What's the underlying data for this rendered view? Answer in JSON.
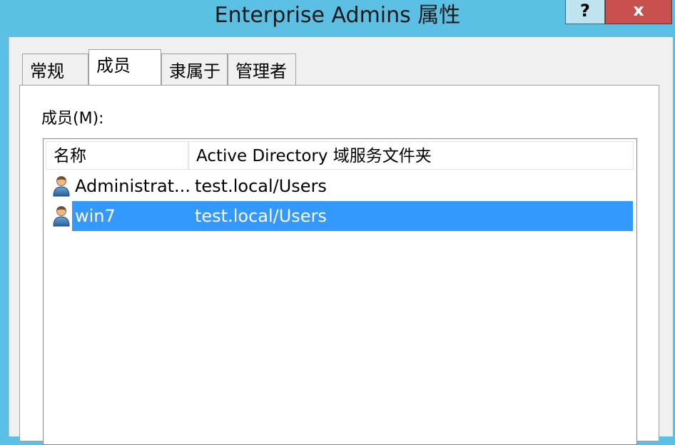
{
  "window": {
    "title": "Enterprise Admins 属性",
    "help_label": "?",
    "close_label": "x"
  },
  "tabs": [
    {
      "label": "常规",
      "active": false
    },
    {
      "label": "成员",
      "active": true
    },
    {
      "label": "隶属于",
      "active": false
    },
    {
      "label": "管理者",
      "active": false
    }
  ],
  "members": {
    "label": "成员(M):",
    "columns": [
      "名称",
      "Active Directory 域服务文件夹"
    ],
    "rows": [
      {
        "name": "Administrat...",
        "folder": "test.local/Users",
        "icon": "user-icon",
        "selected": false
      },
      {
        "name": "win7",
        "folder": "test.local/Users",
        "icon": "user-icon",
        "selected": true
      }
    ]
  },
  "colors": {
    "title_bar": "#5bc0e3",
    "close_button": "#c7504e",
    "selection": "#3399ff"
  }
}
